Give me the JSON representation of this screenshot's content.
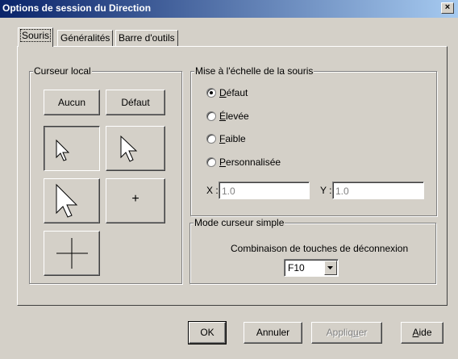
{
  "window": {
    "title": "Options de session du Direction",
    "close_glyph": "×"
  },
  "tabs": [
    {
      "label": "Souris",
      "active": true
    },
    {
      "label": "Généralités",
      "active": false
    },
    {
      "label": "Barre d'outils",
      "active": false
    }
  ],
  "local_cursor": {
    "title": "Curseur local",
    "none_label": "Aucun",
    "default_label": "Défaut",
    "crosshair_small_glyph": "+",
    "cursor_icons": [
      "arrow-cursor-small-icon",
      "arrow-cursor-medium-icon",
      "arrow-cursor-large-icon",
      "crosshair-small-icon",
      "crosshair-large-icon"
    ]
  },
  "mouse_scaling": {
    "title": "Mise à l'échelle de la souris",
    "options": [
      {
        "label": "Défaut",
        "mnemonic": "D",
        "rest": "éfaut",
        "selected": true
      },
      {
        "label": "Élevée",
        "mnemonic": "É",
        "rest": "levée",
        "selected": false
      },
      {
        "label": "Faible",
        "mnemonic": "F",
        "rest": "aible",
        "selected": false
      },
      {
        "label": "Personnalisée",
        "mnemonic": "P",
        "rest": "ersonnalisée",
        "selected": false
      }
    ],
    "x_label": "X :",
    "x_value": "1.0",
    "y_label": "Y :",
    "y_value": "1.0"
  },
  "simple_cursor": {
    "title": "Mode curseur simple",
    "combo_label": "Combinaison de touches de déconnexion",
    "selected_key": "F10"
  },
  "footer": {
    "ok_label": "OK",
    "cancel_label": "Annuler",
    "apply_label": "Appliquer",
    "apply_mnemonic_prefix": "Appliq",
    "apply_mnemonic": "u",
    "apply_mnemonic_suffix": "er",
    "help_mnemonic": "A",
    "help_rest": "ide"
  },
  "colors": {
    "titlebar_start": "#0a246a",
    "titlebar_end": "#a6caf0",
    "face": "#d4d0c8"
  }
}
